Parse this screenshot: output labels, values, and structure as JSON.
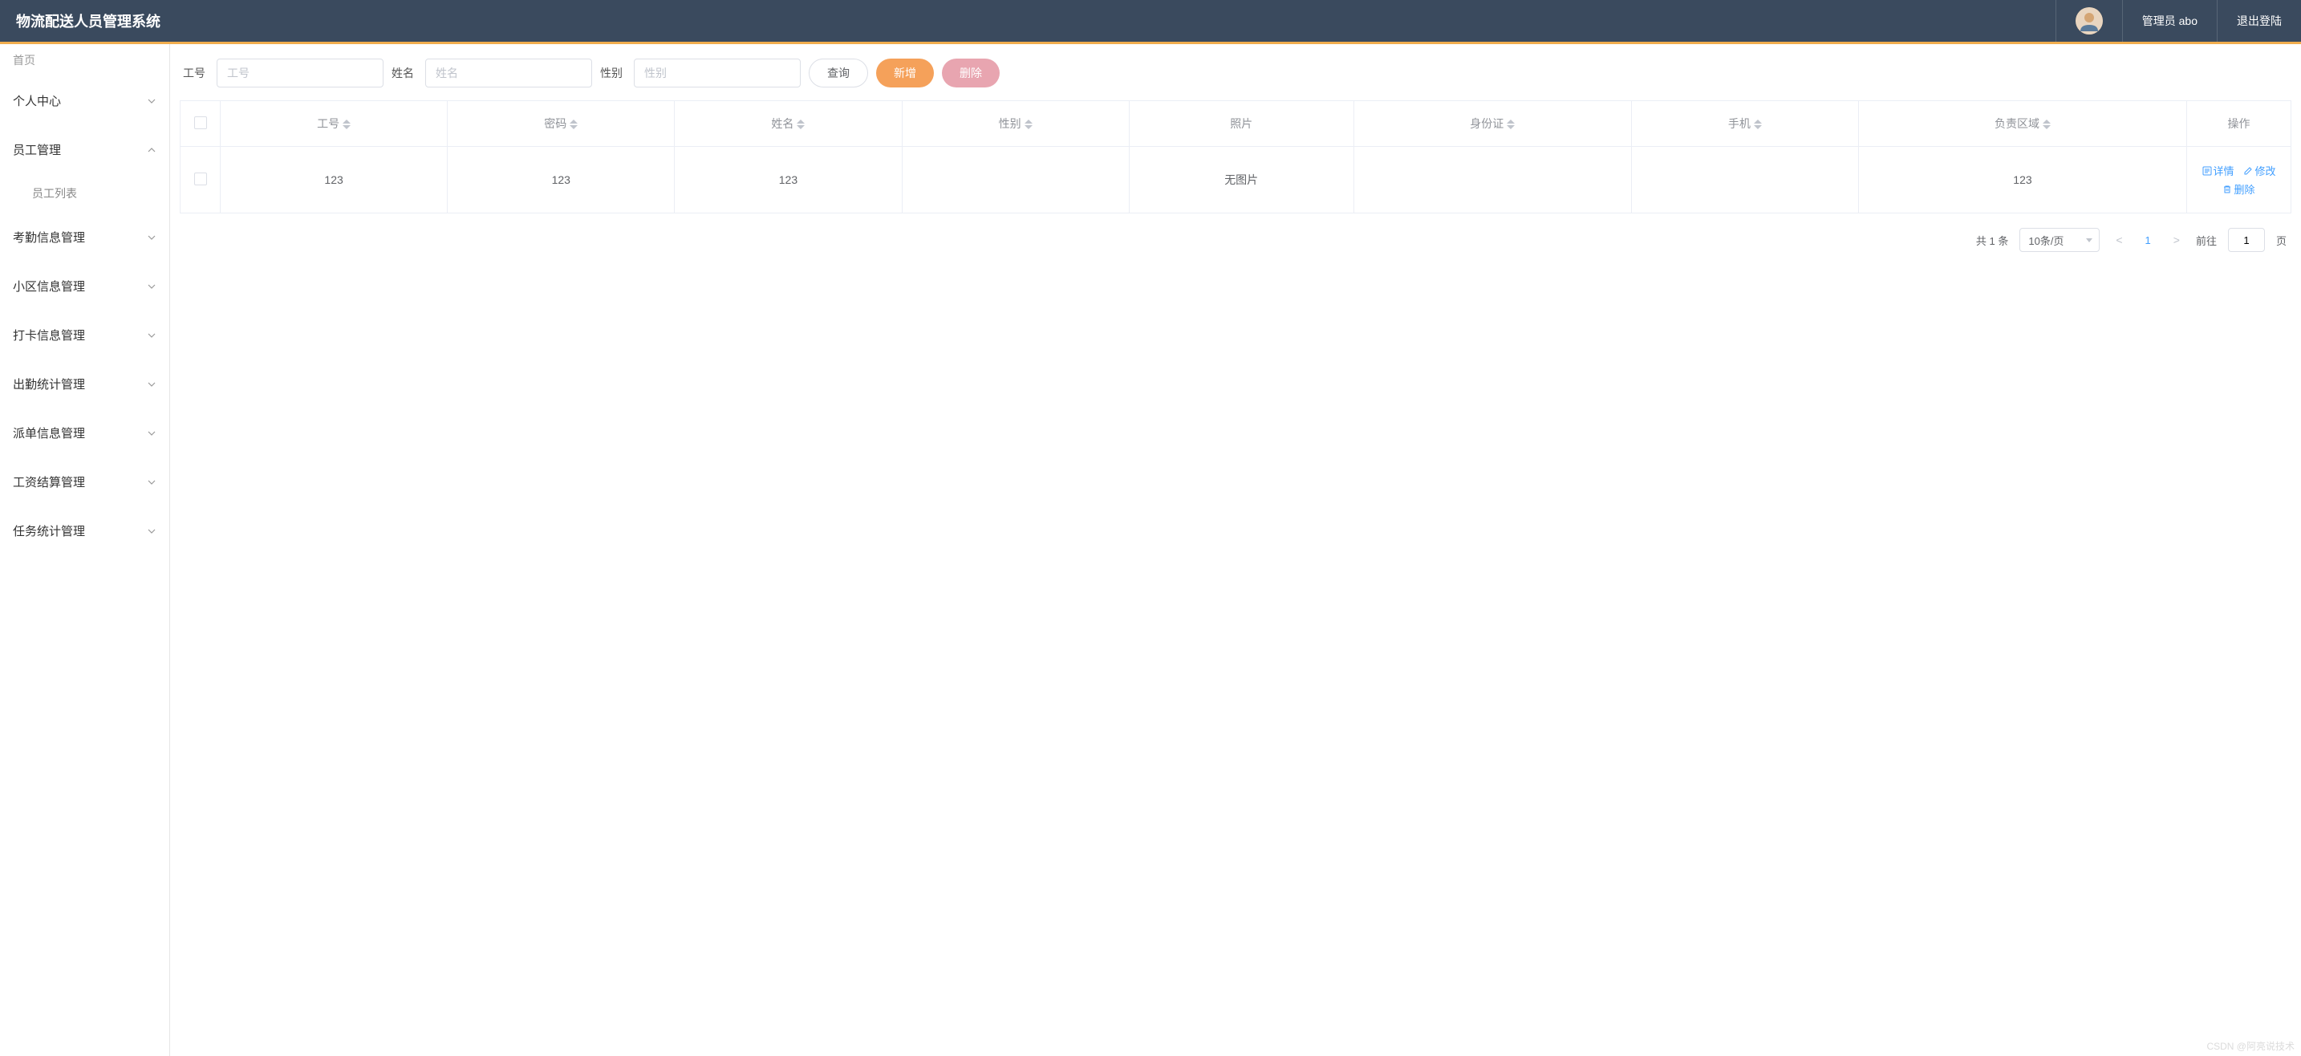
{
  "header": {
    "title": "物流配送人员管理系统",
    "user_label": "管理员 abo",
    "logout_label": "退出登陆"
  },
  "sidebar": {
    "crumb": "首页",
    "items": [
      {
        "label": "个人中心",
        "expanded": false
      },
      {
        "label": "员工管理",
        "expanded": true,
        "children": [
          {
            "label": "员工列表"
          }
        ]
      },
      {
        "label": "考勤信息管理",
        "expanded": false
      },
      {
        "label": "小区信息管理",
        "expanded": false
      },
      {
        "label": "打卡信息管理",
        "expanded": false
      },
      {
        "label": "出勤统计管理",
        "expanded": false
      },
      {
        "label": "派单信息管理",
        "expanded": false
      },
      {
        "label": "工资结算管理",
        "expanded": false
      },
      {
        "label": "任务统计管理",
        "expanded": false
      }
    ]
  },
  "filters": {
    "gonghao_label": "工号",
    "gonghao_placeholder": "工号",
    "xingming_label": "姓名",
    "xingming_placeholder": "姓名",
    "xingbie_label": "性别",
    "xingbie_placeholder": "性别",
    "query_btn": "查询",
    "add_btn": "新增",
    "delete_btn": "删除"
  },
  "table": {
    "columns": [
      "工号",
      "密码",
      "姓名",
      "性别",
      "照片",
      "身份证",
      "手机",
      "负责区域",
      "操作"
    ],
    "rows": [
      {
        "gonghao": "123",
        "mima": "123",
        "xingming": "123",
        "xingbie": "",
        "zhaopian": "无图片",
        "shenfenzheng": "",
        "shouji": "",
        "fuzequyu": "123"
      }
    ],
    "ops": {
      "detail": "详情",
      "edit": "修改",
      "delete": "删除"
    }
  },
  "pagination": {
    "total_prefix": "共",
    "total_count": "1",
    "total_suffix": "条",
    "page_size": "10条/页",
    "current": "1",
    "goto_label": "前往",
    "goto_value": "1",
    "goto_suffix": "页"
  },
  "watermark": "CSDN @阿亮说技术"
}
